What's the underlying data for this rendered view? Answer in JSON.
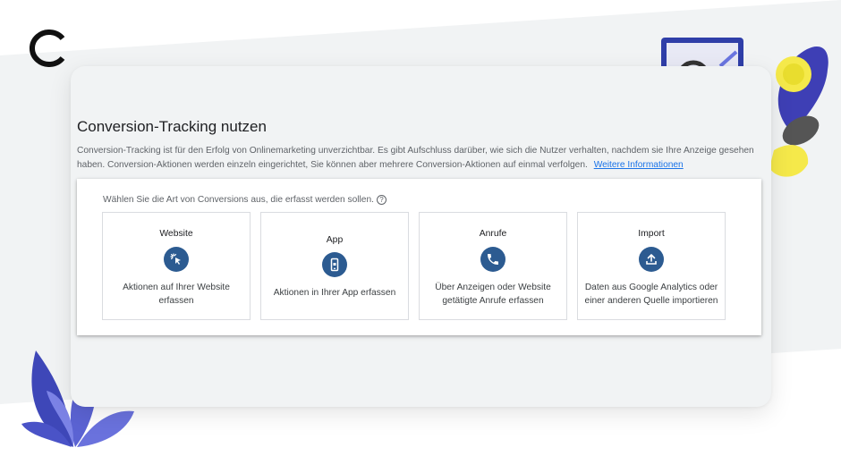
{
  "header": {
    "title": "Conversion-Tracking nutzen",
    "description": "Conversion-Tracking ist für den Erfolg von Onlinemarketing unverzichtbar. Es gibt Aufschluss darüber, wie sich die Nutzer verhalten, nachdem sie Ihre Anzeige gesehen haben. Conversion-Aktionen werden einzeln eingerichtet, Sie können aber mehrere Conversion-Aktionen auf einmal verfolgen.",
    "more_link": "Weitere Informationen"
  },
  "selector": {
    "prompt": "Wählen Sie die Art von Conversions aus, die erfasst werden sollen.",
    "help_icon": "help-circle-icon",
    "options": [
      {
        "title": "Website",
        "icon": "cursor-click-icon",
        "desc_line1": "Aktionen auf Ihrer Website",
        "desc_line2": "erfassen"
      },
      {
        "title": "App",
        "icon": "smartphone-icon",
        "desc_line1": "Aktionen in Ihrer App erfassen",
        "desc_line2": ""
      },
      {
        "title": "Anrufe",
        "icon": "phone-icon",
        "desc_line1": "Über Anzeigen oder Website",
        "desc_line2": "getätigte Anrufe erfassen"
      },
      {
        "title": "Import",
        "icon": "upload-icon",
        "desc_line1": "Daten aus Google Analytics oder",
        "desc_line2": "einer anderen Quelle importieren"
      }
    ]
  },
  "colors": {
    "icon_circle": "#2c5b91",
    "link": "#1a73e8",
    "panel_bg": "#f1f3f4",
    "deco_purple": "#5b63d3",
    "deco_yellow": "#f5e94a"
  }
}
